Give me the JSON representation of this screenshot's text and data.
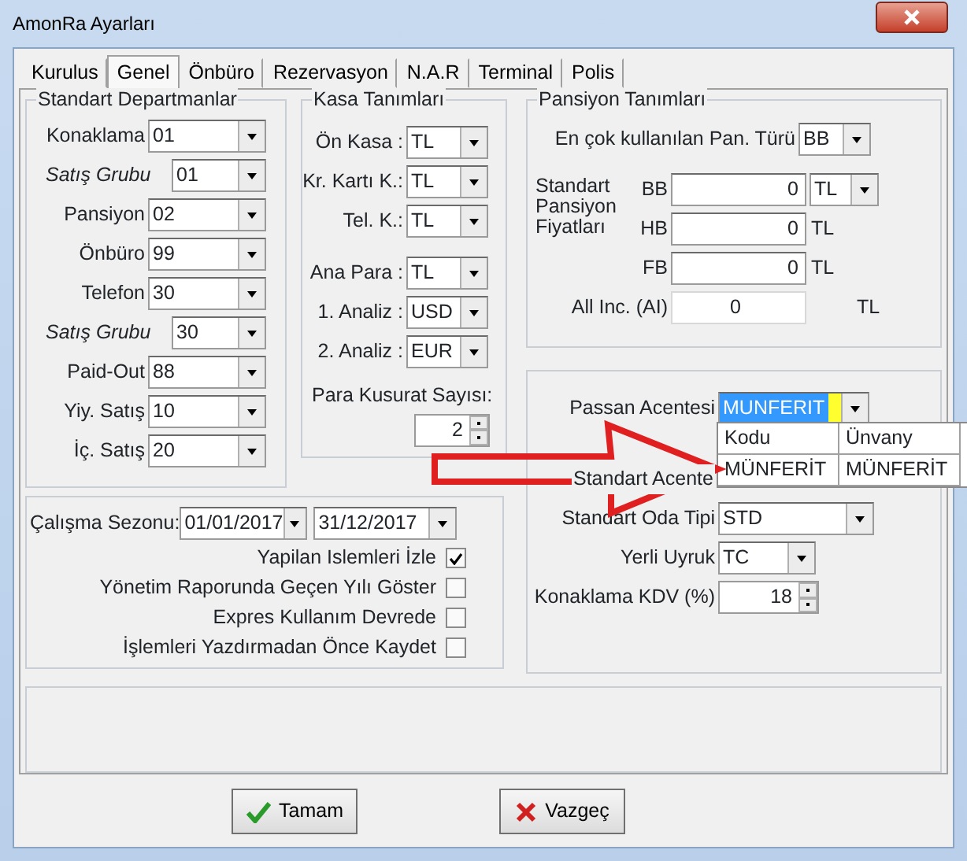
{
  "window": {
    "title": "AmonRa Ayarları"
  },
  "tabs": [
    {
      "label": "Kurulus",
      "selected": false
    },
    {
      "label": "Genel",
      "selected": true
    },
    {
      "label": "Önbüro",
      "selected": false
    },
    {
      "label": "Rezervasyon",
      "selected": false
    },
    {
      "label": "N.A.R",
      "selected": false
    },
    {
      "label": "Terminal",
      "selected": false
    },
    {
      "label": "Polis",
      "selected": false
    }
  ],
  "departments": {
    "title": "Standart Departmanlar",
    "rows": [
      {
        "label": "Konaklama",
        "value": "01",
        "kind": "main"
      },
      {
        "label": "Satış Grubu",
        "value": "01",
        "kind": "sub"
      },
      {
        "label": "Pansiyon",
        "value": "02",
        "kind": "main"
      },
      {
        "label": "Önbüro",
        "value": "99",
        "kind": "main"
      },
      {
        "label": "Telefon",
        "value": "30",
        "kind": "main"
      },
      {
        "label": "Satış Grubu",
        "value": "30",
        "kind": "sub"
      },
      {
        "label": "Paid-Out",
        "value": "88",
        "kind": "main"
      },
      {
        "label": "Yiy. Satış",
        "value": "10",
        "kind": "main"
      },
      {
        "label": "İç. Satış",
        "value": "20",
        "kind": "main"
      }
    ]
  },
  "cash": {
    "title": "Kasa Tanımları",
    "accounts": [
      {
        "label": "Ön Kasa :",
        "value": "TL"
      },
      {
        "label": "Kr. Kartı K.:",
        "value": "TL"
      },
      {
        "label": "Tel. K.:",
        "value": "TL"
      }
    ],
    "currencies": [
      {
        "label": "Ana Para :",
        "value": "TL"
      },
      {
        "label": "1. Analiz :",
        "value": "USD"
      },
      {
        "label": "2. Analiz :",
        "value": "EUR"
      }
    ],
    "decimal_label": "Para Kusurat Sayısı:",
    "decimal_value": "2"
  },
  "board": {
    "title": "Pansiyon Tanımları",
    "most_used_label": "En çok kullanılan Pan. Türü",
    "most_used_value": "BB",
    "prices_label": "Standart Pansiyon Fiyatları",
    "prices": [
      {
        "code": "BB",
        "value": "0",
        "currency": "TL",
        "kind": "combo"
      },
      {
        "code": "HB",
        "value": "0",
        "currency": "TL",
        "kind": "text"
      },
      {
        "code": "FB",
        "value": "0",
        "currency": "TL",
        "kind": "text"
      },
      {
        "code": "All Inc. (AI)",
        "value": "0",
        "currency": "TL",
        "kind": "wide"
      }
    ]
  },
  "agency": {
    "passan_label": "Passan Acentesi",
    "passan_value": "MUNFERIT",
    "passan_focused": true,
    "standard_agency_label": "Standart Acente",
    "room_type_label": "Standart Oda Tipi",
    "room_type_value": "STD",
    "nationality_label": "Yerli Uyruk",
    "nationality_value": "TC",
    "vat_label": "Konaklama KDV (%)",
    "vat_value": "18"
  },
  "popup": {
    "columns": [
      "Kodu",
      "Ünvany"
    ],
    "rows": [
      [
        "MÜNFERİT",
        "MÜNFERİT"
      ]
    ]
  },
  "season": {
    "label": "Çalışma Sezonu:",
    "start": "01/01/2017",
    "end": "31/12/2017",
    "options": [
      {
        "label": "Yapilan Islemleri İzle",
        "checked": true
      },
      {
        "label": "Yönetim Raporunda Geçen Yılı Göster",
        "checked": false
      },
      {
        "label": "Expres Kullanım Devrede",
        "checked": false
      },
      {
        "label": "İşlemleri Yazdırmadan Önce Kaydet",
        "checked": false
      }
    ]
  },
  "buttons": [
    {
      "label": "Tamam",
      "kind": "ok"
    },
    {
      "label": "Vazgeç",
      "kind": "cancel"
    }
  ]
}
